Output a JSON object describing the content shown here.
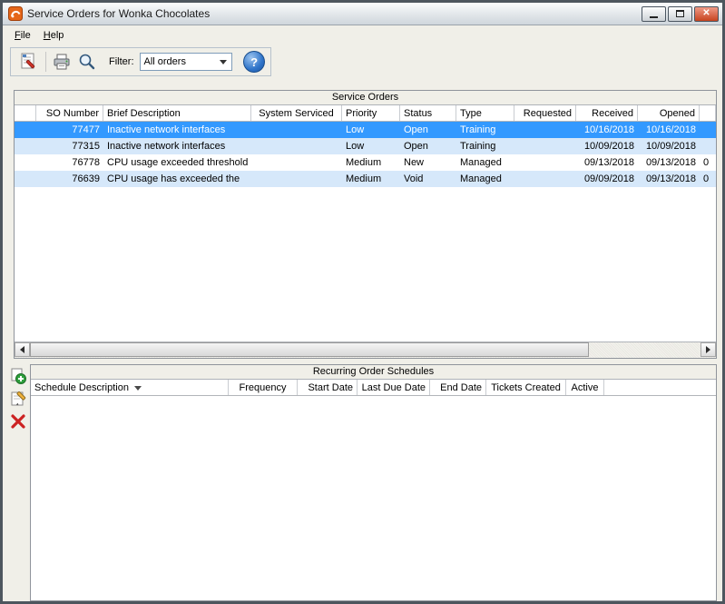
{
  "window": {
    "title": "Service Orders for Wonka Chocolates"
  },
  "menu": {
    "file": "File",
    "help": "Help"
  },
  "toolbar": {
    "filter_label": "Filter:",
    "filter_value": "All orders",
    "help_glyph": "?",
    "icons": [
      "new-service-order-icon",
      "print-icon",
      "search-icon",
      "help-icon"
    ]
  },
  "service_orders": {
    "title": "Service Orders",
    "columns": {
      "c0": "",
      "c1": "SO Number",
      "c2": "Brief Description",
      "c3": "System Serviced",
      "c4": "Priority",
      "c5": "Status",
      "c6": "Type",
      "c7": "Requested",
      "c8": "Received",
      "c9": "Opened",
      "c10": ""
    },
    "rows": [
      {
        "so": "77477",
        "desc": "Inactive network interfaces",
        "system": "",
        "priority": "Low",
        "status": "Open",
        "type": "Training",
        "requested": "",
        "received": "10/16/2018",
        "opened": "10/16/2018",
        "extra": ""
      },
      {
        "so": "77315",
        "desc": "Inactive network interfaces",
        "system": "",
        "priority": "Low",
        "status": "Open",
        "type": "Training",
        "requested": "",
        "received": "10/09/2018",
        "opened": "10/09/2018",
        "extra": ""
      },
      {
        "so": "76778",
        "desc": "CPU usage exceeded threshold",
        "system": "",
        "priority": "Medium",
        "status": "New",
        "type": "Managed",
        "requested": "",
        "received": "09/13/2018",
        "opened": "09/13/2018",
        "extra": "0"
      },
      {
        "so": "76639",
        "desc": "CPU usage has exceeded the",
        "system": "",
        "priority": "Medium",
        "status": "Void",
        "type": "Managed",
        "requested": "",
        "received": "09/09/2018",
        "opened": "09/13/2018",
        "extra": "0"
      }
    ]
  },
  "recurring": {
    "title": "Recurring Order Schedules",
    "columns": {
      "c0": "Schedule Description",
      "c1": "Frequency",
      "c2": "Start Date",
      "c3": "Last Due Date",
      "c4": "End Date",
      "c5": "Tickets Created",
      "c6": "Active"
    },
    "sorted_by": "Schedule Description",
    "sort_direction": "desc",
    "left_actions": [
      "add",
      "edit",
      "delete"
    ]
  },
  "colors": {
    "selected_row_bg": "#3399FF",
    "alt_row_bg": "#D6E8FA",
    "close_red": "#C7431F",
    "help_blue": "#2F74C9",
    "add_green": "#2E9E3C",
    "delete_red": "#CC2222"
  }
}
